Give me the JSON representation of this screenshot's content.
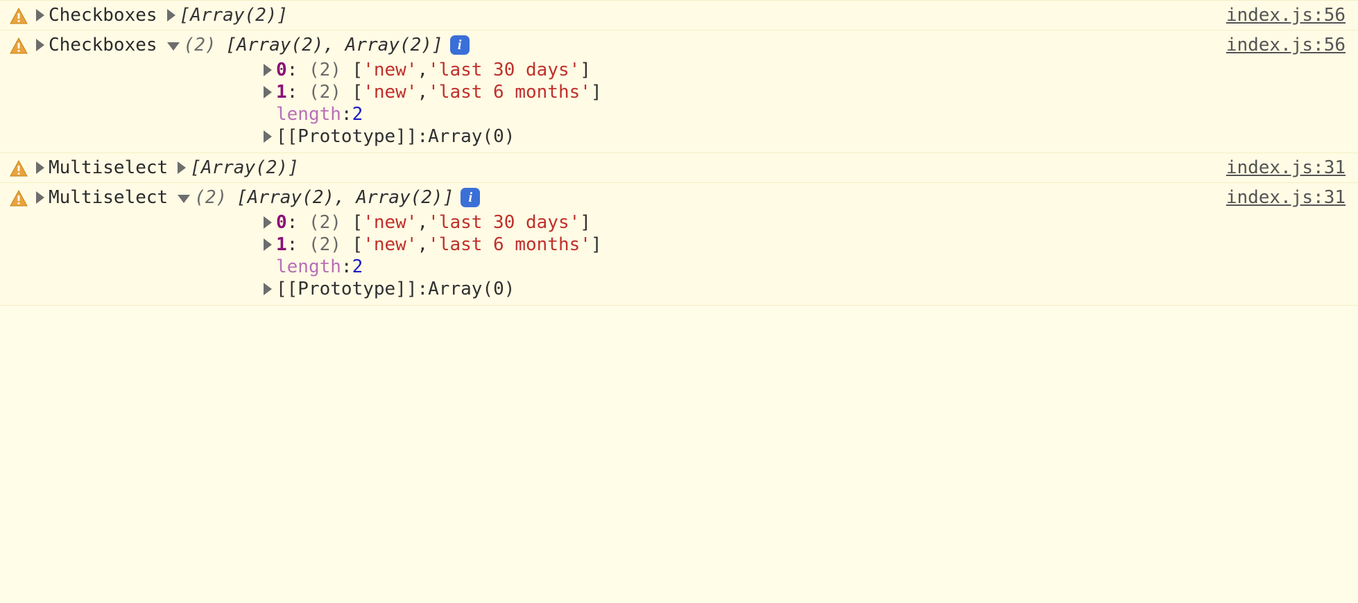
{
  "rows": [
    {
      "label": "Checkboxes",
      "collapsedSummary": "[Array(2)]",
      "expanded": false,
      "source": "index.js:56"
    },
    {
      "label": "Checkboxes",
      "expanded": true,
      "expandedHeader": {
        "count": "(2)",
        "body": "[Array(2), Array(2)]"
      },
      "items": [
        {
          "key": "0",
          "count": "(2)",
          "open": "[",
          "v1": "'new'",
          "sep": ", ",
          "v2": "'last 30 days'",
          "close": "]"
        },
        {
          "key": "1",
          "count": "(2)",
          "open": "[",
          "v1": "'new'",
          "sep": ", ",
          "v2": "'last 6 months'",
          "close": "]"
        }
      ],
      "length": {
        "key": "length",
        "sep": ": ",
        "val": "2"
      },
      "proto": {
        "label": "[[Prototype]]",
        "sep": ": ",
        "val": "Array(0)"
      },
      "source": "index.js:56"
    },
    {
      "label": "Multiselect",
      "collapsedSummary": "[Array(2)]",
      "expanded": false,
      "source": "index.js:31"
    },
    {
      "label": "Multiselect",
      "expanded": true,
      "expandedHeader": {
        "count": "(2)",
        "body": "[Array(2), Array(2)]"
      },
      "items": [
        {
          "key": "0",
          "count": "(2)",
          "open": "[",
          "v1": "'new'",
          "sep": ", ",
          "v2": "'last 30 days'",
          "close": "]"
        },
        {
          "key": "1",
          "count": "(2)",
          "open": "[",
          "v1": "'new'",
          "sep": ", ",
          "v2": "'last 6 months'",
          "close": "]"
        }
      ],
      "length": {
        "key": "length",
        "sep": ": ",
        "val": "2"
      },
      "proto": {
        "label": "[[Prototype]]",
        "sep": ": ",
        "val": "Array(0)"
      },
      "source": "index.js:31"
    }
  ],
  "infoGlyph": "i"
}
